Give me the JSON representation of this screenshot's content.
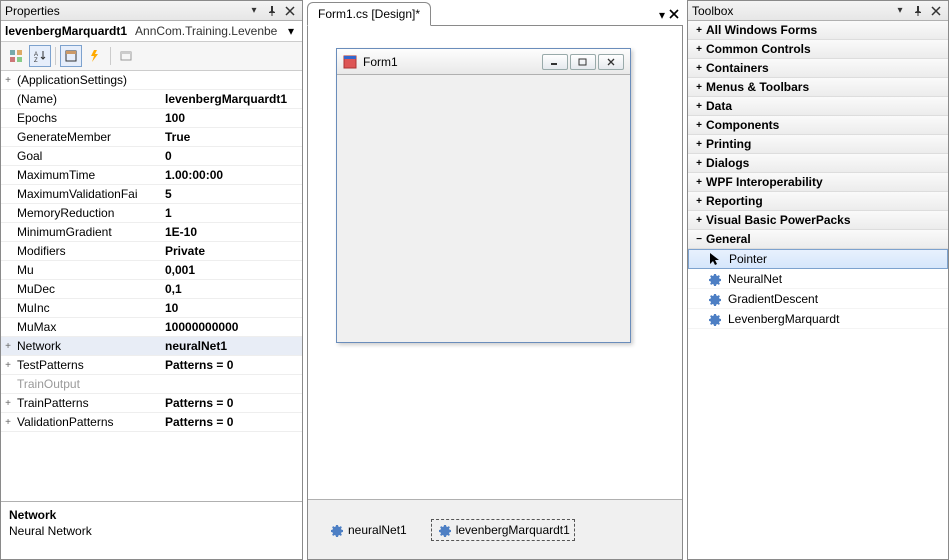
{
  "properties": {
    "title": "Properties",
    "selector_name": "levenbergMarquardt1",
    "selector_type": "AnnCom.Training.Levenbe",
    "toolbar": {
      "categorized": "categorized-icon",
      "alphabetical": "alphabetical-icon",
      "properties": "properties-icon",
      "events": "events-icon",
      "propertyPages": "property-pages-icon"
    },
    "rows": [
      {
        "expand": "+",
        "name": "(ApplicationSettings)",
        "value": ""
      },
      {
        "expand": "",
        "name": "(Name)",
        "value": "levenbergMarquardt1"
      },
      {
        "expand": "",
        "name": "Epochs",
        "value": "100"
      },
      {
        "expand": "",
        "name": "GenerateMember",
        "value": "True"
      },
      {
        "expand": "",
        "name": "Goal",
        "value": "0"
      },
      {
        "expand": "",
        "name": "MaximumTime",
        "value": "1.00:00:00"
      },
      {
        "expand": "",
        "name": "MaximumValidationFai",
        "value": "5"
      },
      {
        "expand": "",
        "name": "MemoryReduction",
        "value": "1"
      },
      {
        "expand": "",
        "name": "MinimumGradient",
        "value": "1E-10"
      },
      {
        "expand": "",
        "name": "Modifiers",
        "value": "Private"
      },
      {
        "expand": "",
        "name": "Mu",
        "value": "0,001"
      },
      {
        "expand": "",
        "name": "MuDec",
        "value": "0,1"
      },
      {
        "expand": "",
        "name": "MuInc",
        "value": "10"
      },
      {
        "expand": "",
        "name": "MuMax",
        "value": "10000000000"
      },
      {
        "expand": "+",
        "name": "Network",
        "value": "neuralNet1",
        "selected": true
      },
      {
        "expand": "+",
        "name": "TestPatterns",
        "value": "Patterns = 0"
      },
      {
        "expand": "",
        "name": "TrainOutput",
        "value": "",
        "disabled": true
      },
      {
        "expand": "+",
        "name": "TrainPatterns",
        "value": "Patterns = 0"
      },
      {
        "expand": "+",
        "name": "ValidationPatterns",
        "value": "Patterns = 0"
      }
    ],
    "desc_name": "Network",
    "desc_text": "Neural Network"
  },
  "designer": {
    "tab_label": "Form1.cs [Design]*",
    "form_title": "Form1",
    "components": [
      {
        "name": "neuralNet1",
        "selected": false
      },
      {
        "name": "levenbergMarquardt1",
        "selected": true
      }
    ]
  },
  "toolbox": {
    "title": "Toolbox",
    "categories": [
      {
        "label": "All Windows Forms",
        "expanded": false
      },
      {
        "label": "Common Controls",
        "expanded": false
      },
      {
        "label": "Containers",
        "expanded": false
      },
      {
        "label": "Menus & Toolbars",
        "expanded": false
      },
      {
        "label": "Data",
        "expanded": false
      },
      {
        "label": "Components",
        "expanded": false
      },
      {
        "label": "Printing",
        "expanded": false
      },
      {
        "label": "Dialogs",
        "expanded": false
      },
      {
        "label": "WPF Interoperability",
        "expanded": false
      },
      {
        "label": "Reporting",
        "expanded": false
      },
      {
        "label": "Visual Basic PowerPacks",
        "expanded": false
      },
      {
        "label": "General",
        "expanded": true
      }
    ],
    "general_items": [
      {
        "label": "Pointer",
        "icon": "pointer",
        "selected": true
      },
      {
        "label": "NeuralNet",
        "icon": "gear"
      },
      {
        "label": "GradientDescent",
        "icon": "gear"
      },
      {
        "label": "LevenbergMarquardt",
        "icon": "gear"
      }
    ]
  }
}
